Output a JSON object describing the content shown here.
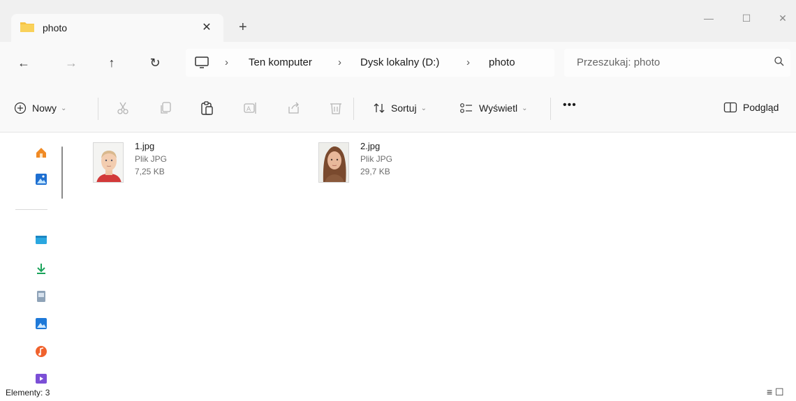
{
  "window": {
    "tab_title": "photo",
    "tab_close": "✕",
    "new_tab": "+",
    "minimize": "—",
    "maximize": "☐",
    "close": "✕"
  },
  "nav": {
    "back": "←",
    "forward": "→",
    "up": "↑",
    "refresh": "↻",
    "breadcrumb": [
      "Ten komputer",
      "Dysk lokalny (D:)",
      "photo"
    ],
    "separator": "›",
    "search_placeholder": "Przeszukaj: photo"
  },
  "commands": {
    "new_label": "Nowy",
    "sort_label": "Sortuj",
    "view_label": "Wyświetl",
    "more_label": "•••",
    "preview_label": "Podgląd",
    "caret": "⌄"
  },
  "files": [
    {
      "name": "1.jpg",
      "type": "Plik JPG",
      "size": "7,25 KB"
    },
    {
      "name": "2.jpg",
      "type": "Plik JPG",
      "size": "29,7 KB"
    }
  ],
  "status": {
    "count": "Elementy: 3",
    "views_icon": "≡ ☐"
  },
  "colors": {
    "accent": "#0067c0",
    "folder": "#f6c343",
    "titlebar": "#f0f0f0",
    "toolbar": "#f9f9f9"
  }
}
